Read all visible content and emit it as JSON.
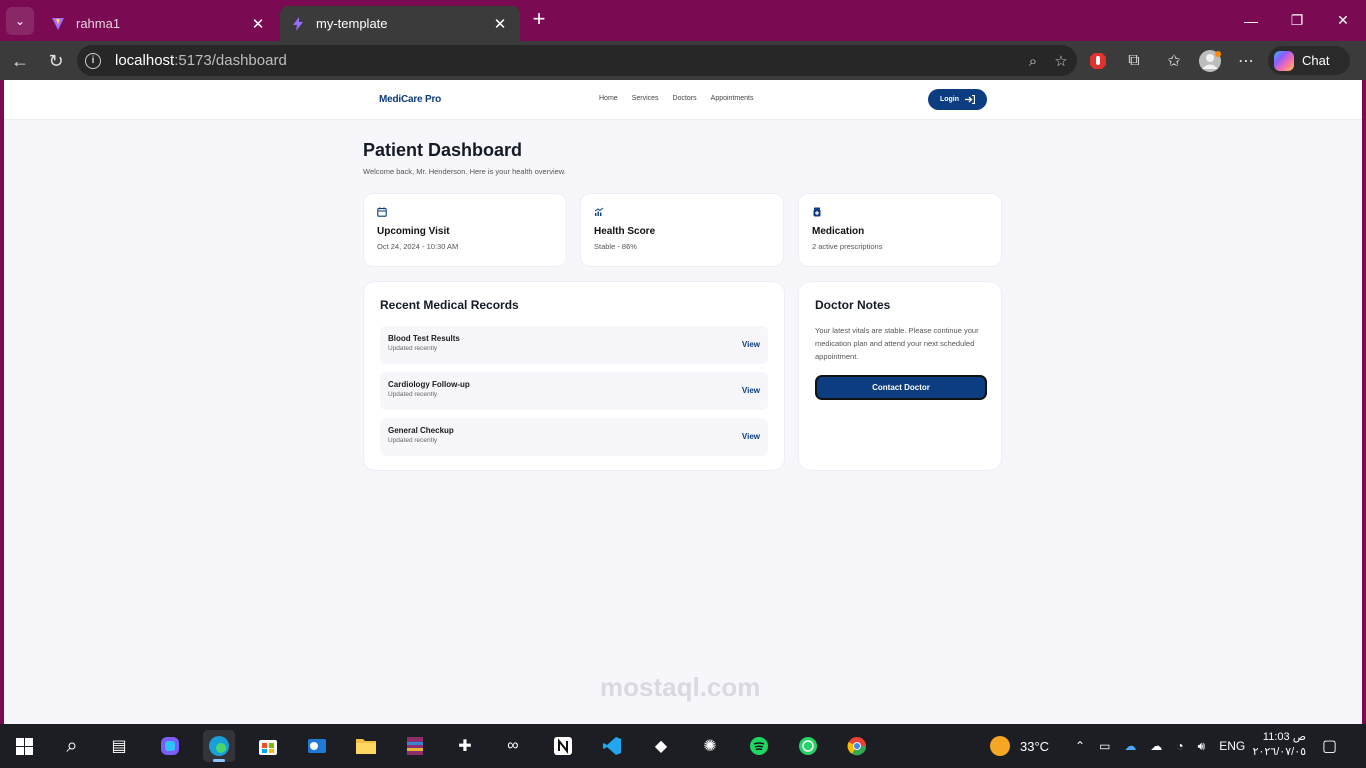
{
  "browser": {
    "tabs": [
      {
        "title": "rahma1",
        "active": false
      },
      {
        "title": "my-template",
        "active": true
      }
    ],
    "url_host": "localhost",
    "url_rest": ":5173/dashboard",
    "chat_label": "Chat"
  },
  "site": {
    "brand": "MediCare Pro",
    "nav": [
      "Home",
      "Services",
      "Doctors",
      "Appointments"
    ],
    "login_label": "Login"
  },
  "dashboard": {
    "title": "Patient Dashboard",
    "subtitle": "Welcome back, Mr. Henderson. Here is your health overview.",
    "cards": [
      {
        "icon": "calendar-icon",
        "title": "Upcoming Visit",
        "value": "Oct 24, 2024 - 10:30 AM"
      },
      {
        "icon": "chart-icon",
        "title": "Health Score",
        "value": "Stable - 86%"
      },
      {
        "icon": "medication-icon",
        "title": "Medication",
        "value": "2 active prescriptions"
      }
    ],
    "records": {
      "title": "Recent Medical Records",
      "items": [
        {
          "name": "Blood Test Results",
          "meta": "Updated recently",
          "action": "View"
        },
        {
          "name": "Cardiology Follow-up",
          "meta": "Updated recently",
          "action": "View"
        },
        {
          "name": "General Checkup",
          "meta": "Updated recently",
          "action": "View"
        }
      ]
    },
    "notes": {
      "title": "Doctor Notes",
      "text": "Your latest vitals are stable. Please continue your medication plan and attend your next scheduled appointment.",
      "button": "Contact Doctor"
    }
  },
  "watermark": "mostaql.com",
  "taskbar": {
    "weather": "33°C",
    "language": "ENG",
    "time": "11:03 ص",
    "date": "٢٠٢٦/٠٧/٠٥"
  },
  "colors": {
    "brand_primary": "#0b3d80",
    "titlebar": "#7a0a52",
    "page_bg": "#f7f7fb"
  }
}
